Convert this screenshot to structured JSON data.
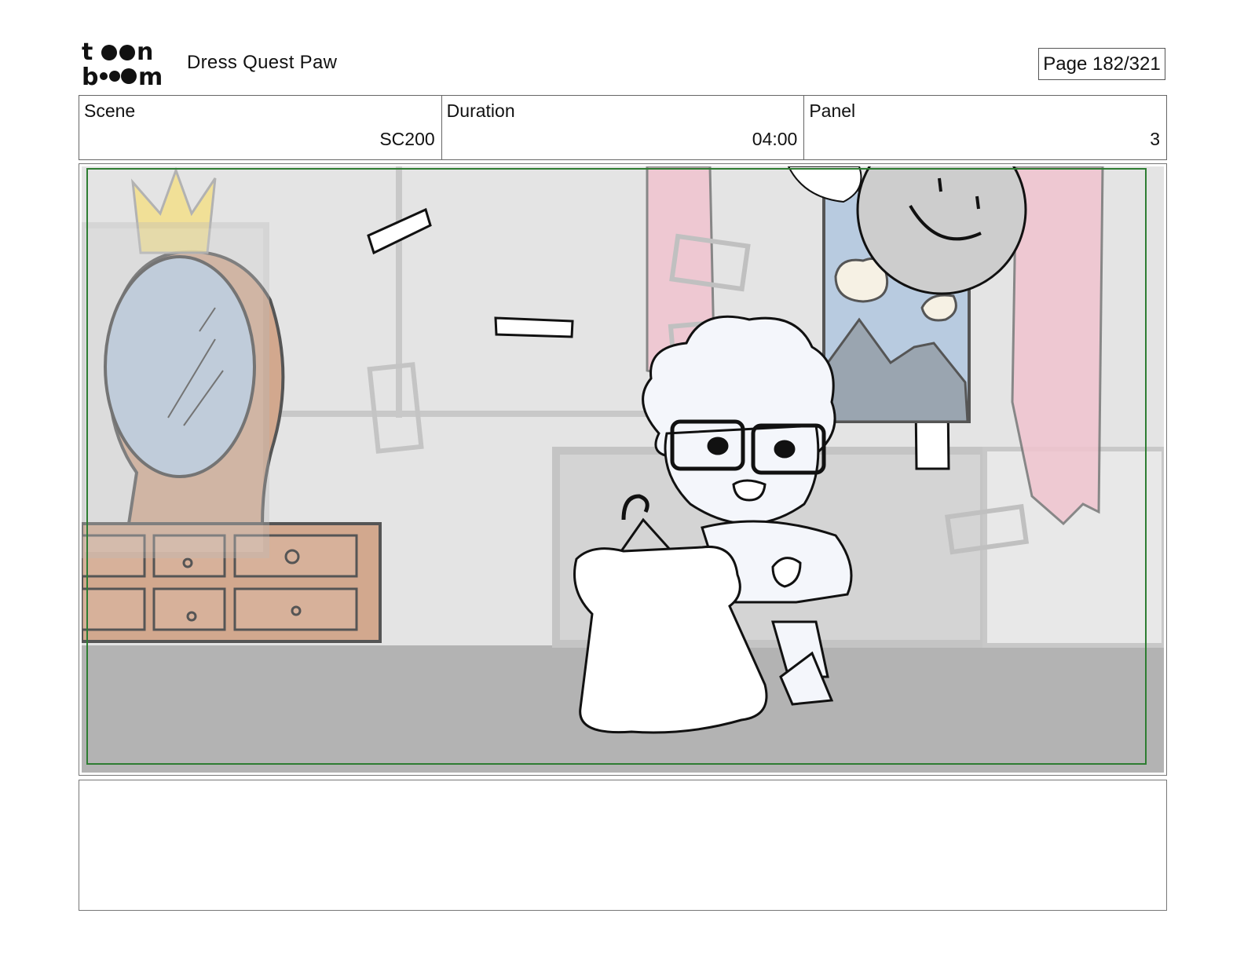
{
  "header": {
    "logo_text_top": "toon",
    "logo_text_bottom": "boom",
    "project_title": "Dress Quest Paw",
    "page_indicator": "Page 182/321"
  },
  "info": {
    "scene": {
      "label": "Scene",
      "value": "SC200"
    },
    "duration": {
      "label": "Duration",
      "value": "04:00"
    },
    "panel": {
      "label": "Panel",
      "value": "3"
    }
  },
  "notes": {
    "text": ""
  },
  "colors": {
    "safe_frame": "#2e7d32",
    "wall": "#e4e4e4",
    "floor": "#b3b3b3",
    "mirror_glass": "#b8cbe0",
    "wood": "#d2a88e",
    "curtain": "#f0c4cf",
    "crown": "#f4e08a"
  }
}
